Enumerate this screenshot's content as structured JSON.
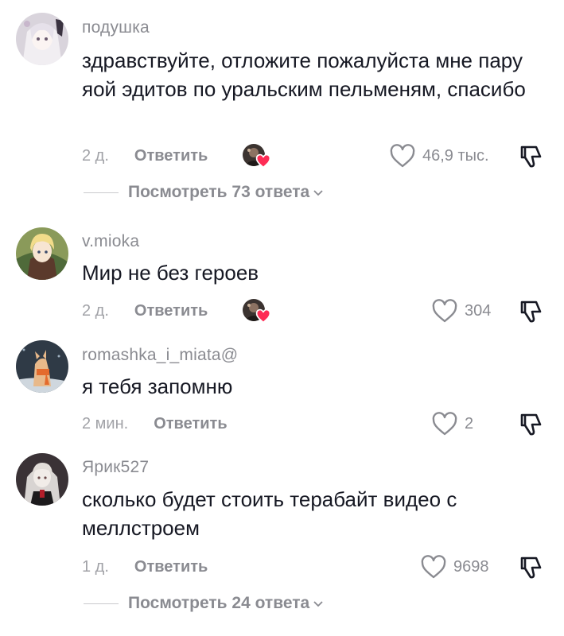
{
  "comments": [
    {
      "username": "подушка",
      "text": "здравствуйте, отложите пожалуйста мне пару яой эдитов по уральским пельменям, спасибо",
      "time": "2 д.",
      "reply_label": "Ответить",
      "likes": "46,9 тыс.",
      "creator_liked": true,
      "view_replies": "Посмотреть 73 ответа"
    },
    {
      "username": "v.mioka",
      "text": "Мир не без героев",
      "time": "2 д.",
      "reply_label": "Ответить",
      "likes": "304",
      "creator_liked": true
    },
    {
      "username": "romashka_i_miata@",
      "text": "я тебя запомню",
      "time": "2 мин.",
      "reply_label": "Ответить",
      "likes": "2",
      "creator_liked": false
    },
    {
      "username": "Ярик527",
      "text": "сколько будет стоить терабайт видео с меллстроем",
      "time": "1 д.",
      "reply_label": "Ответить",
      "likes": "9698",
      "creator_liked": false,
      "view_replies": "Посмотреть 24 ответа"
    }
  ],
  "icons": {
    "like": "heart-outline-icon",
    "dislike": "thumbs-down-icon",
    "creator_heart": "heart-filled-icon",
    "expand": "chevron-down-icon"
  },
  "colors": {
    "creator_heart": "#fe2c55",
    "secondary_text": "#8a8b91",
    "primary_text": "#161823"
  }
}
